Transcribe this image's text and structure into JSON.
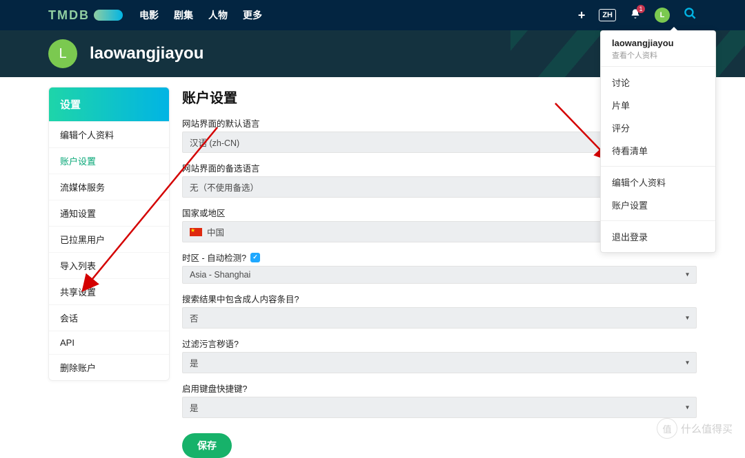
{
  "brand": "TMDB",
  "nav": {
    "movies": "电影",
    "tv": "剧集",
    "people": "人物",
    "more": "更多"
  },
  "header": {
    "lang": "ZH",
    "notif_count": "1",
    "avatar_letter": "L"
  },
  "hero": {
    "avatar_letter": "L",
    "username": "laowangjiayou"
  },
  "dropdown": {
    "user": "laowangjiayou",
    "view_profile": "查看个人资料",
    "items1": [
      "讨论",
      "片单",
      "评分",
      "待看清单"
    ],
    "items2": [
      "编辑个人资料",
      "账户设置"
    ],
    "items3": [
      "退出登录"
    ]
  },
  "sidebar": {
    "head": "设置",
    "items": [
      "编辑个人资料",
      "账户设置",
      "流媒体服务",
      "通知设置",
      "已拉黑用户",
      "导入列表",
      "共享设置",
      "会话",
      "API",
      "删除账户"
    ],
    "active_index": 1
  },
  "settings": {
    "title": "账户设置",
    "lang_default_label": "网站界面的默认语言",
    "lang_default_value": "汉语 (zh-CN)",
    "lang_fallback_label": "网站界面的备选语言",
    "lang_fallback_value": "无（不使用备选）",
    "country_label": "国家或地区",
    "country_value": "中国",
    "timezone_label": "时区 - 自动检测?",
    "timezone_value": "Asia - Shanghai",
    "adult_label": "搜索结果中包含成人内容条目?",
    "adult_value": "否",
    "profanity_label": "过滤污言秽语?",
    "profanity_value": "是",
    "shortcuts_label": "启用键盘快捷键?",
    "shortcuts_value": "是",
    "save": "保存"
  },
  "watermark": "什么值得买"
}
